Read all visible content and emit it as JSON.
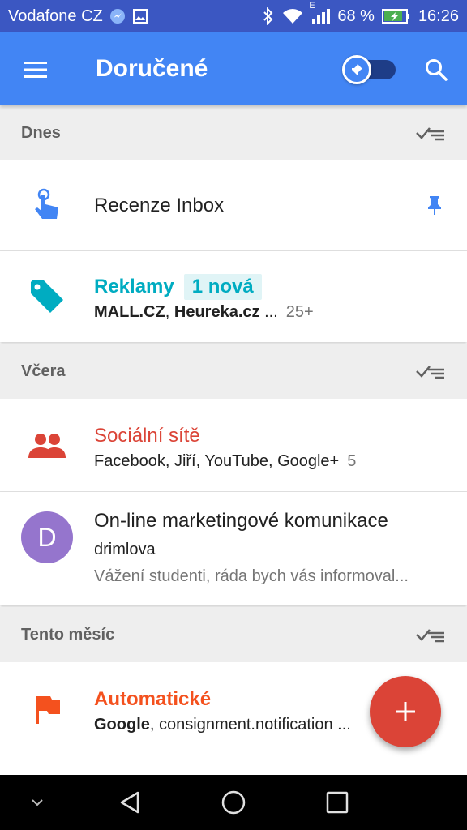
{
  "status_bar": {
    "carrier": "Vodafone CZ",
    "battery_percent": "68 %",
    "time": "16:26",
    "network_type": "E",
    "icons": [
      "messenger-icon",
      "image-icon",
      "bluetooth-icon",
      "wifi-icon",
      "signal-icon",
      "battery-charging-icon"
    ]
  },
  "app_bar": {
    "title": "Doručené",
    "menu_icon": "hamburger-menu-icon",
    "pin_toggle_icon": "pin-icon",
    "pin_toggle_on": false,
    "search_icon": "search-icon",
    "color": "#4285f4"
  },
  "sections": [
    {
      "title": "Dnes",
      "sweep_icon": "sweep-done-icon",
      "items": [
        {
          "icon": "gesture-tap-icon",
          "icon_color": "#4285f4",
          "title": "Recenze Inbox",
          "pinned": true
        }
      ]
    },
    {
      "title": "",
      "items": [
        {
          "icon": "tag-icon",
          "icon_color": "#00acc1",
          "title": "Reklamy",
          "badge": "1 nová",
          "senders_bold": "MALL.CZ",
          "senders_sep": ", ",
          "senders_bold2": "Heureka.cz",
          "senders_rest": " ...",
          "count": "25+"
        }
      ]
    },
    {
      "title": "Včera",
      "sweep_icon": "sweep-done-icon",
      "items": [
        {
          "icon": "people-icon",
          "icon_color": "#db4437",
          "title": "Sociální sítě",
          "senders": "Facebook, Jiří, YouTube, Google+",
          "count": "5"
        },
        {
          "avatar_letter": "D",
          "avatar_color": "#9575cd",
          "title": "On-line marketingové komunikace",
          "sender": "drimlova",
          "snippet": "Vážení studenti, ráda bych vás informoval..."
        }
      ]
    },
    {
      "title": "Tento měsíc",
      "sweep_icon": "sweep-done-icon",
      "items": [
        {
          "icon": "flag-icon",
          "icon_color": "#f4511e",
          "title": "Automatické",
          "senders_bold": "Google",
          "senders_rest": ", consignment.notification ..."
        }
      ]
    }
  ],
  "fab": {
    "icon": "plus-icon",
    "color": "#db4437"
  },
  "nav_bar": {
    "icons": [
      "chevron-down-icon",
      "back-icon",
      "home-icon",
      "recents-icon"
    ]
  }
}
